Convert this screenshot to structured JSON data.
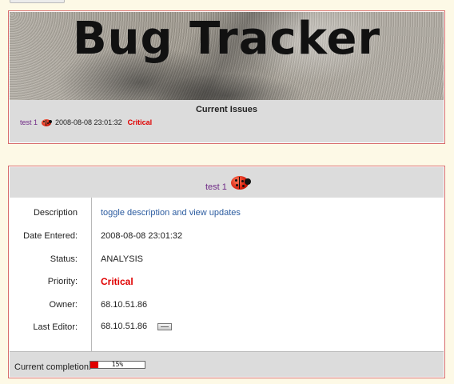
{
  "header": {
    "title": "Bug Tracker"
  },
  "current_issues": {
    "heading": "Current Issues",
    "items": [
      {
        "name": "test 1",
        "timestamp": "2008-08-08 23:01:32",
        "priority": "Critical",
        "icon": "ladybug-icon"
      }
    ]
  },
  "bug_detail": {
    "title": "test 1",
    "icon": "ladybug-icon",
    "fields": {
      "description_label": "Description",
      "description_value": "toggle description and view updates",
      "date_entered_label": "Date Entered:",
      "date_entered_value": "2008-08-08 23:01:32",
      "status_label": "Status:",
      "status_value": "ANALYSIS",
      "priority_label": "Priority:",
      "priority_value": "Critical",
      "owner_label": "Owner:",
      "owner_value": "68.10.51.86",
      "last_editor_label": "Last Editor:",
      "last_editor_value": "68.10.51.86",
      "last_editor_icon": "edit-icon"
    },
    "completion": {
      "label": "Current completion:",
      "percent_text": "15%",
      "fraction": 0.15
    }
  },
  "colors": {
    "background": "#fdf9e6",
    "panel_border": "#d76c6c",
    "header_gray": "#dcdcdc",
    "critical": "#e00000",
    "link_purple": "#6f2a86",
    "link_blue": "#2c5ca0"
  }
}
